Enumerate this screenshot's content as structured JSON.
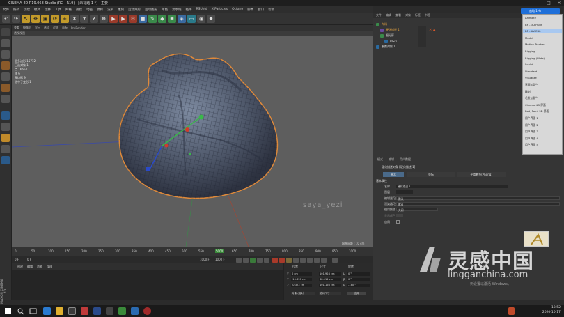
{
  "window": {
    "title": "CINEMA 4D R19.068 Studio (RC - R19) - [未标题 1 *] - 主要"
  },
  "menubar": [
    "文件",
    "编辑",
    "创建",
    "模式",
    "选择",
    "工具",
    "网格",
    "捕捉",
    "动画",
    "模拟",
    "渲染",
    "雕刻",
    "运动跟踪",
    "运动图形",
    "角色",
    "流水线",
    "插件",
    "RSUeld",
    "X-Particles",
    "Octane",
    "脚本",
    "窗口",
    "帮助"
  ],
  "toolbar": {
    "x": "X",
    "y": "Y",
    "z": "Z"
  },
  "viewport": {
    "menu": [
      "查看",
      "摄像机",
      "显示",
      "选项",
      "过滤",
      "面板",
      "ProRender"
    ],
    "tag": "透视视图",
    "stats_labels": [
      "总多边形",
      "已选对象",
      "点",
      "线",
      "多边形"
    ],
    "stats_values": [
      "15712",
      "1",
      "16664",
      "6",
      "9"
    ],
    "stats_extra": "选中子变形 1",
    "watermark": "saya_yezi",
    "grid_info": "网格间距 : 10 cm"
  },
  "timeline": {
    "ticks": [
      "0",
      "50",
      "100",
      "150",
      "200",
      "250",
      "300",
      "350",
      "400",
      "450",
      "500",
      "550",
      "600",
      "650",
      "700",
      "750",
      "800",
      "850",
      "900",
      "950",
      "1000"
    ],
    "current": "5000",
    "start": "0 F",
    "start2": "0 F",
    "end": "1000 F",
    "end2": "1000 F",
    "frame": "0 F"
  },
  "materials": {
    "tabs": [
      "创建",
      "编辑",
      "功能",
      "纹理"
    ]
  },
  "coords": {
    "headers": [
      "位置",
      "尺寸",
      "旋转"
    ],
    "labels": [
      "X",
      "Y",
      "Z",
      "H",
      "P",
      "B"
    ],
    "position": [
      "0 cm",
      "-15.837 cm",
      "-0.323 cm"
    ],
    "size": [
      "101.928 cm",
      "88.112 cm",
      "101.166 cm"
    ],
    "rotation": [
      "0 °",
      "0 °",
      "-180 °"
    ],
    "mode1": "对象 (相对)",
    "mode2": "绝对尺寸",
    "apply": "应用"
  },
  "object_manager": {
    "tabs": [
      "文件",
      "编辑",
      "查看",
      "对象",
      "标签",
      "书签"
    ],
    "items": [
      "布料",
      "硬化描述 1",
      "细分形",
      "BISO",
      "参数对象 1"
    ]
  },
  "layout": {
    "button": "启动 1 布",
    "items": [
      "Animate",
      "BP - 3D Paint",
      "BP - UV Edit",
      "Model",
      "Motion Tracker",
      "Rigging",
      "Rigging (Wide)",
      "Sculpt",
      "Standard",
      "Visualize",
      "界面 (用户)",
      "雕刻",
      "毛发 (用户)",
      "Cinema 4D 界面",
      "BodyPaint 3D 界面",
      "用户界面 1",
      "用户界面 2",
      "用户界面 3",
      "用户界面 4",
      "用户界面 5"
    ],
    "highlight_index": 2
  },
  "attributes": {
    "menu": [
      "模式",
      "编辑",
      "用户数据"
    ],
    "object": "硬化描述对象 [硬化描述 1]",
    "tabs": [
      "基本",
      "坐标",
      "平滑着色(Phong)"
    ],
    "section": "基本属性",
    "name_label": "名称",
    "name_value": "硬化描述 1",
    "layer_label": "图层",
    "rows": [
      {
        "label": "编辑器可见",
        "value": "默认"
      },
      {
        "label": "渲染器可见",
        "value": "默认"
      },
      {
        "label": "使用颜色",
        "value": "关闭"
      }
    ],
    "display_label": "显示颜色",
    "enable_label": "启用"
  },
  "sidebrand": "MAXON CINEMA 4D",
  "site_watermark": {
    "cn": "灵感中国",
    "en": "lingganchina.com",
    "sub": "到设置以激活 Windows。"
  },
  "clock": {
    "time": "13:52",
    "date": "2020-10-17"
  }
}
